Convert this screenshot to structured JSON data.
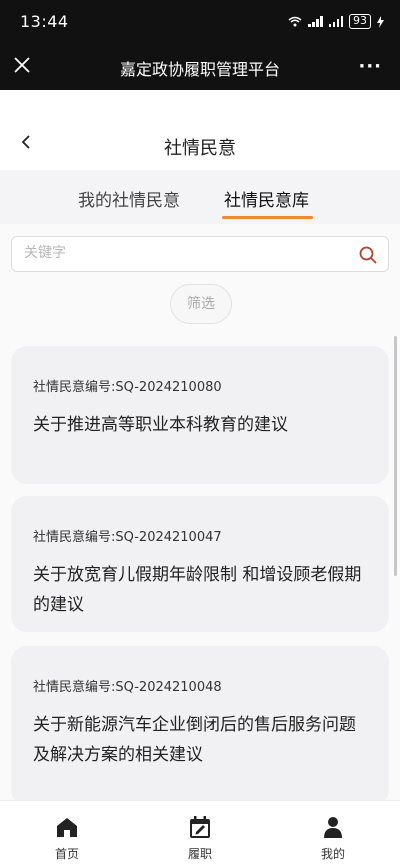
{
  "status_bar": {
    "time": "13:44",
    "battery": "93",
    "icons": [
      "wifi-icon",
      "signal-icon",
      "signal-icon",
      "battery-icon",
      "charging-icon"
    ]
  },
  "app_bar": {
    "title": "嘉定政协履职管理平台",
    "more_label": "···"
  },
  "page": {
    "title": "社情民意"
  },
  "tabs": [
    {
      "label": "我的社情民意",
      "active": false
    },
    {
      "label": "社情民意库",
      "active": true
    }
  ],
  "search": {
    "placeholder": "关键字",
    "value": ""
  },
  "filter": {
    "label": "筛选"
  },
  "cards": [
    {
      "number": "社情民意编号:SQ-2024210080",
      "title": "关于推进高等职业本科教育的建议"
    },
    {
      "number": "社情民意编号:SQ-2024210047",
      "title": "关于放宽育儿假期年龄限制 和增设顾老假期的建议"
    },
    {
      "number": "社情民意编号:SQ-2024210048",
      "title": "关于新能源汽车企业倒闭后的售后服务问题及解决方案的相关建议"
    }
  ],
  "bottom_nav": [
    {
      "label": "首页",
      "icon": "home-icon"
    },
    {
      "label": "履职",
      "icon": "calendar-icon"
    },
    {
      "label": "我的",
      "icon": "user-icon"
    }
  ],
  "colors": {
    "accent": "#f28a2b",
    "search_icon": "#b5432c",
    "header_bg": "#111111"
  }
}
